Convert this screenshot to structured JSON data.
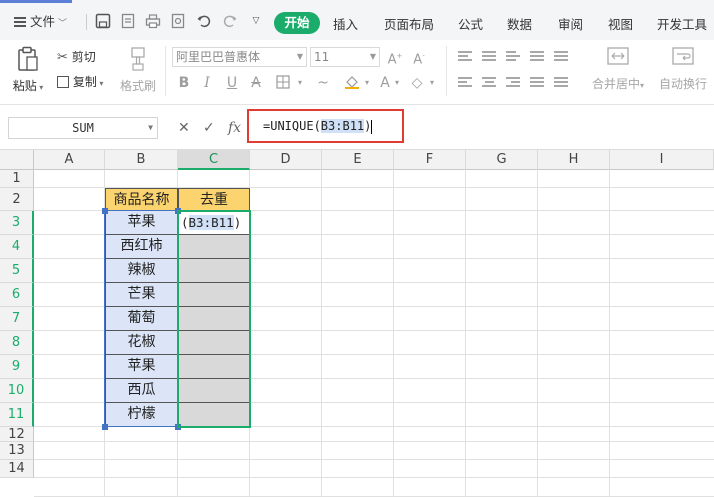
{
  "menubar": {
    "file_label": "文件",
    "tabs": [
      "开始",
      "插入",
      "页面布局",
      "公式",
      "数据",
      "审阅",
      "视图",
      "开发工具"
    ],
    "active_tab": "开始"
  },
  "ribbon": {
    "paste_label": "粘贴",
    "cut_label": "剪切",
    "copy_label": "复制",
    "format_painter_label": "格式刷",
    "font_name": "阿里巴巴普惠体",
    "font_size": "11",
    "merge_label": "合并居中",
    "wrap_label": "自动换行"
  },
  "formula_bar": {
    "name_box": "SUM",
    "formula_prefix": "=UNIQUE(",
    "formula_ref": "B3:B11",
    "formula_suffix": ")"
  },
  "sheet": {
    "columns": [
      "A",
      "B",
      "C",
      "D",
      "E",
      "F",
      "G",
      "H",
      "I"
    ],
    "rows": [
      "1",
      "2",
      "3",
      "4",
      "5",
      "6",
      "7",
      "8",
      "9",
      "10",
      "11",
      "12",
      "13",
      "14"
    ],
    "header_name": "商品名称",
    "header_result": "去重",
    "names": [
      "苹果",
      "西红柿",
      "辣椒",
      "芒果",
      "葡萄",
      "花椒",
      "苹果",
      "西瓜",
      "柠檬"
    ],
    "c3_open": "(",
    "c3_ref": "B3:B11",
    "c3_close": ")"
  },
  "colors": {
    "accent": "#1bac6b",
    "header_fill": "#fbd46f",
    "name_fill": "#dbe5f7",
    "result_fill": "#d9d9d9",
    "highlight_border": "#e03c31"
  }
}
